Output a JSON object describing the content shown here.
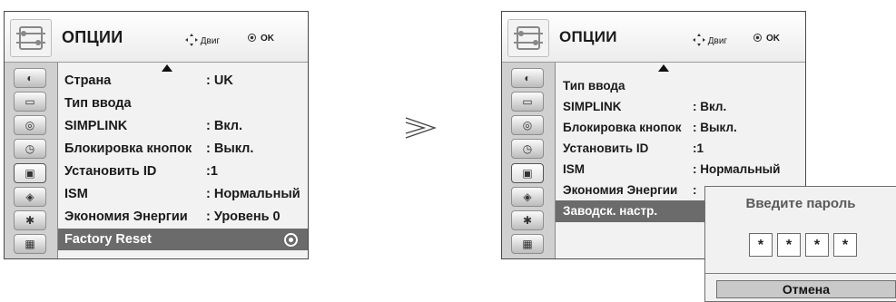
{
  "header": {
    "title": "ОПЦИИ",
    "nav_hint": "Двиг",
    "ok_hint": "OK"
  },
  "sidebar_icons": [
    "picture-icon",
    "screen-icon",
    "audio-icon",
    "time-icon",
    "options-icon",
    "lock-icon",
    "input-icon",
    "usb-icon"
  ],
  "left_menu": {
    "items": [
      {
        "label": "Страна",
        "value": ": UK"
      },
      {
        "label": "Тип ввода",
        "value": ""
      },
      {
        "label": "SIMPLINK",
        "value": ": Вкл."
      },
      {
        "label": "Блокировка кнопок",
        "value": ": Выкл."
      },
      {
        "label": "Установить ID",
        "value": ":1"
      },
      {
        "label": "ISM",
        "value": ": Нормальный"
      },
      {
        "label": "Экономия Энергии",
        "value": ": Уровень 0"
      },
      {
        "label": "Factory Reset",
        "value": ""
      }
    ],
    "selected_index": 7
  },
  "right_menu": {
    "items": [
      {
        "label": "Тип ввода",
        "value": ""
      },
      {
        "label": "SIMPLINK",
        "value": ": Вкл."
      },
      {
        "label": "Блокировка кнопок",
        "value": ": Выкл."
      },
      {
        "label": "Установить ID",
        "value": ":1"
      },
      {
        "label": "ISM",
        "value": ": Нормальный"
      },
      {
        "label": "Экономия Энергии",
        "value": ":"
      },
      {
        "label": "Заводск. настр.",
        "value": ""
      }
    ],
    "selected_index": 6
  },
  "dialog": {
    "title": "Введите пароль",
    "password_chars": [
      "*",
      "*",
      "*",
      "*"
    ],
    "cancel_label": "Отмена"
  },
  "colors": {
    "selected_row": "#6b6b6b",
    "panel_bg": "#dcdcdc"
  }
}
